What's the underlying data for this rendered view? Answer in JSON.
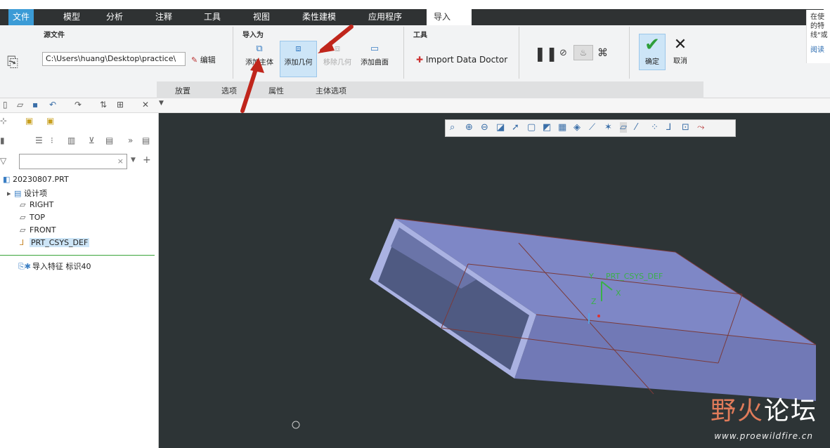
{
  "menu": {
    "file": "文件",
    "tabs": [
      "模型",
      "分析",
      "注释",
      "工具",
      "视图",
      "柔性建模",
      "应用程序",
      "导入"
    ]
  },
  "ribbon": {
    "source_label": "源文件",
    "source_path": "C:\\Users\\huang\\Desktop\\practice\\",
    "edit_label": "编辑",
    "import_as_label": "导入为",
    "tools_label": "工具",
    "add_body": "添加主体",
    "add_geometry": "添加几何",
    "remove_geometry": "移除几何",
    "add_surface": "添加曲面",
    "import_doctor": "Import Data Doctor",
    "ok": "确定",
    "cancel": "取消",
    "subtabs": [
      "放置",
      "选项",
      "属性",
      "主体选项"
    ],
    "help_lines": [
      "在使",
      "的特",
      "线\"或",
      "阅读"
    ]
  },
  "tree": {
    "root": "20230807.PRT",
    "items": [
      "设计项",
      "RIGHT",
      "TOP",
      "FRONT",
      "PRT_CSYS_DEF"
    ],
    "feature": "导入特征 标识40"
  },
  "viewport": {
    "csys_label": "PRT_CSYS_DEF",
    "axis_x": "X",
    "axis_y": "Y",
    "axis_z": "Z"
  },
  "watermark": {
    "brand_a": "野火",
    "brand_b": "论坛",
    "url": "www.proewildfire.cn"
  },
  "colors": {
    "accent": "#3b9bd6",
    "model_face": "#7e87c6",
    "viewport_bg": "#2d3436"
  }
}
